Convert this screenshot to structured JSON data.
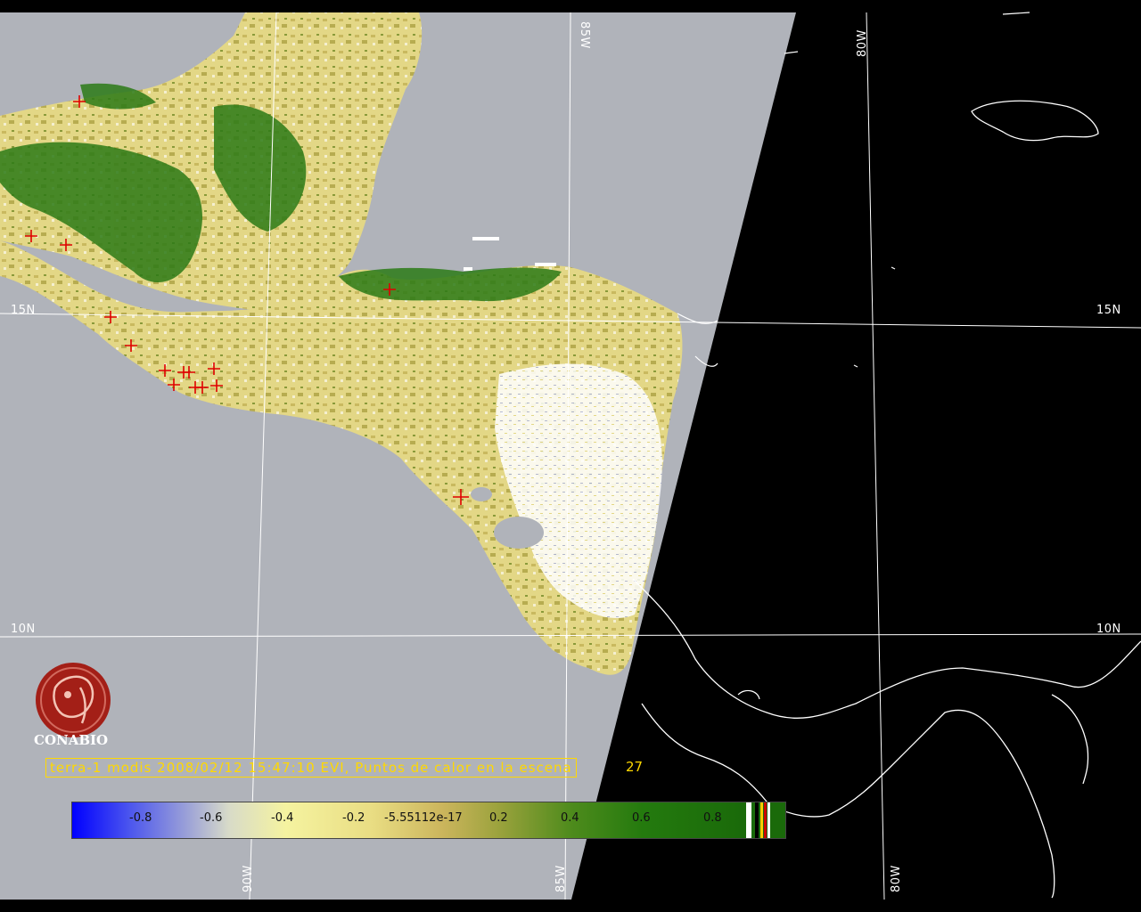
{
  "map": {
    "grid_labels": {
      "lat_15n_left": "15N",
      "lat_15n_right": "15N",
      "lat_10n_left": "10N",
      "lat_10n_right": "10N",
      "lon_85w_top": "85W",
      "lon_80w_top": "80W",
      "lon_90w_bottom": "90W",
      "lon_85w_bottom": "85W",
      "lon_80w_bottom": "80W"
    },
    "colors": {
      "ocean": "#b0b3ba",
      "night": "#000000",
      "vegetation_dark": "#2c7a16",
      "vegetation_light": "#e6dc85",
      "hotspot": "#e00000",
      "coastline": "#ffffff",
      "grid": "#ffffff"
    }
  },
  "logo": {
    "name": "CONABIO",
    "icon": "conabio-logo-icon",
    "color": "#a31f17"
  },
  "caption": {
    "text": "terra-1 modis 2008/02/12 15:47:10 EVI, Puntos de calor en la escena",
    "count": "27",
    "color": "#ffd800"
  },
  "colorbar": {
    "ticks": [
      "-0.8",
      "-0.6",
      "-0.4",
      "-0.2",
      "-5.55112e-17",
      "0.2",
      "0.4",
      "0.6",
      "0.8"
    ]
  }
}
